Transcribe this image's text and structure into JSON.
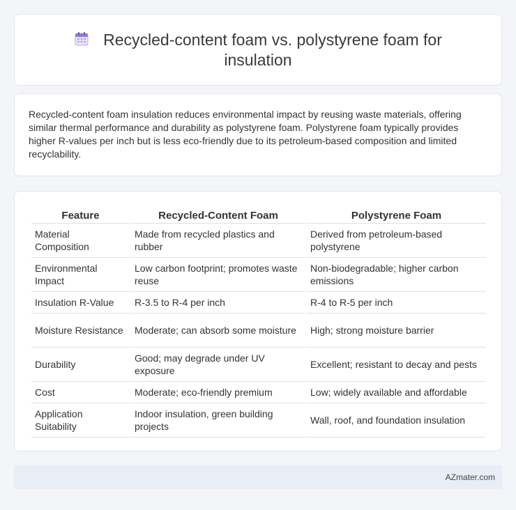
{
  "header": {
    "title": "Recycled-content foam vs. polystyrene foam for insulation",
    "icon": "calendar-icon"
  },
  "description": "Recycled-content foam insulation reduces environmental impact by reusing waste materials, offering similar thermal performance and durability as polystyrene foam. Polystyrene foam typically provides higher R-values per inch but is less eco-friendly due to its petroleum-based composition and limited recyclability.",
  "table": {
    "headers": [
      "Feature",
      "Recycled-Content Foam",
      "Polystyrene Foam"
    ],
    "rows": [
      [
        "Material Composition",
        "Made from recycled plastics and rubber",
        "Derived from petroleum-based polystyrene"
      ],
      [
        "Environmental Impact",
        "Low carbon footprint; promotes waste reuse",
        "Non-biodegradable; higher carbon emissions"
      ],
      [
        "Insulation R-Value",
        "R-3.5 to R-4 per inch",
        "R-4 to R-5 per inch"
      ],
      [
        "Moisture Resistance",
        "Moderate; can absorb some moisture",
        "High; strong moisture barrier"
      ],
      [
        "Durability",
        "Good; may degrade under UV exposure",
        "Excellent; resistant to decay and pests"
      ],
      [
        "Cost",
        "Moderate; eco-friendly premium",
        "Low; widely available and affordable"
      ],
      [
        "Application Suitability",
        "Indoor insulation, green building projects",
        "Wall, roof, and foundation insulation"
      ]
    ]
  },
  "footer": {
    "site": "AZmater.com"
  }
}
